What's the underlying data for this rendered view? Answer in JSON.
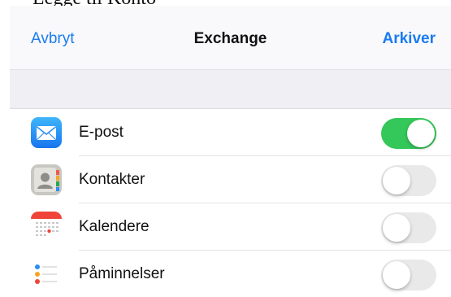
{
  "top_text": "Legge til Konto",
  "nav": {
    "cancel_label": "Avbryt",
    "title": "Exchange",
    "save_label": "Arkiver"
  },
  "colors": {
    "accent": "#1a7bf2",
    "toggle_on": "#34c759",
    "toggle_off": "#e9e9ea",
    "group_background": "#efeff4"
  },
  "items": [
    {
      "label": "E-post",
      "icon": "mail-icon",
      "enabled": true
    },
    {
      "label": "Kontakter",
      "icon": "contacts-icon",
      "enabled": false
    },
    {
      "label": "Kalendere",
      "icon": "calendar-icon",
      "enabled": false
    },
    {
      "label": "Påminnelser",
      "icon": "reminders-icon",
      "enabled": false
    }
  ]
}
